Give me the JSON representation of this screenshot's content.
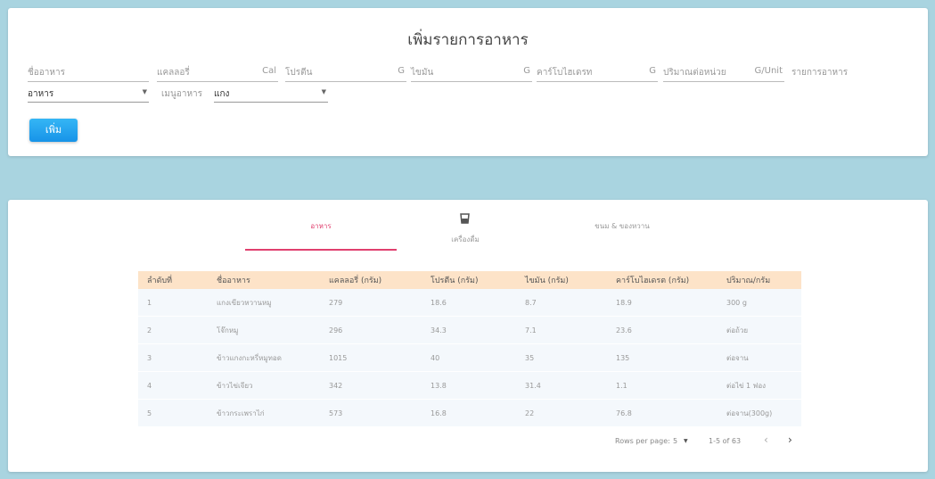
{
  "form": {
    "title": "เพิ่มรายการอาหาร",
    "fields": [
      {
        "label": "ชื่ออาหาร",
        "unit": ""
      },
      {
        "label": "แคลลอรี่",
        "unit": "Cal"
      },
      {
        "label": "โปรตีน",
        "unit": "G"
      },
      {
        "label": "ไขมัน",
        "unit": "G"
      },
      {
        "label": "คาร์โบไฮเดรท",
        "unit": "G"
      },
      {
        "label": "ปริมาณต่อหน่วย",
        "unit": "G/Unit"
      }
    ],
    "list_label": "รายการอาหาร",
    "category_select": "อาหาร",
    "menu_label": "เมนูอาหาร",
    "menu_select": "แกง",
    "add_button": "เพิ่ม"
  },
  "tabs": [
    {
      "label": "อาหาร",
      "icon": ""
    },
    {
      "label": "เครื่องดื่ม",
      "icon": "cup-icon"
    },
    {
      "label": "ขนม & ของหวาน",
      "icon": ""
    }
  ],
  "table": {
    "headers": [
      "ลำดับที่",
      "ชื่ออาหาร",
      "แคลลอรี่ (กรัม)",
      "โปรตีน (กรัม)",
      "ไขมัน (กรัม)",
      "คาร์โบไฮเดรต (กรัม)",
      "ปริมาณ/กรัม"
    ],
    "rows": [
      [
        "1",
        "แกงเขียวหวานหมู",
        "279",
        "18.6",
        "8.7",
        "18.9",
        "300 g"
      ],
      [
        "2",
        "โจ๊กหมู",
        "296",
        "34.3",
        "7.1",
        "23.6",
        "ต่อถ้วย"
      ],
      [
        "3",
        "ข้าวแกงกะหรี่หมูทอด",
        "1015",
        "40",
        "35",
        "135",
        "ต่อจาน"
      ],
      [
        "4",
        "ข้าวไข่เจียว",
        "342",
        "13.8",
        "31.4",
        "1.1",
        "ต่อไข่ 1 ฟอง"
      ],
      [
        "5",
        "ข้าวกระเพราไก่",
        "573",
        "16.8",
        "22",
        "76.8",
        "ต่อจาน(300g)"
      ]
    ]
  },
  "pagination": {
    "rows_per_page_label": "Rows per page:",
    "rows_per_page": "5",
    "range": "1-5 of 63"
  }
}
